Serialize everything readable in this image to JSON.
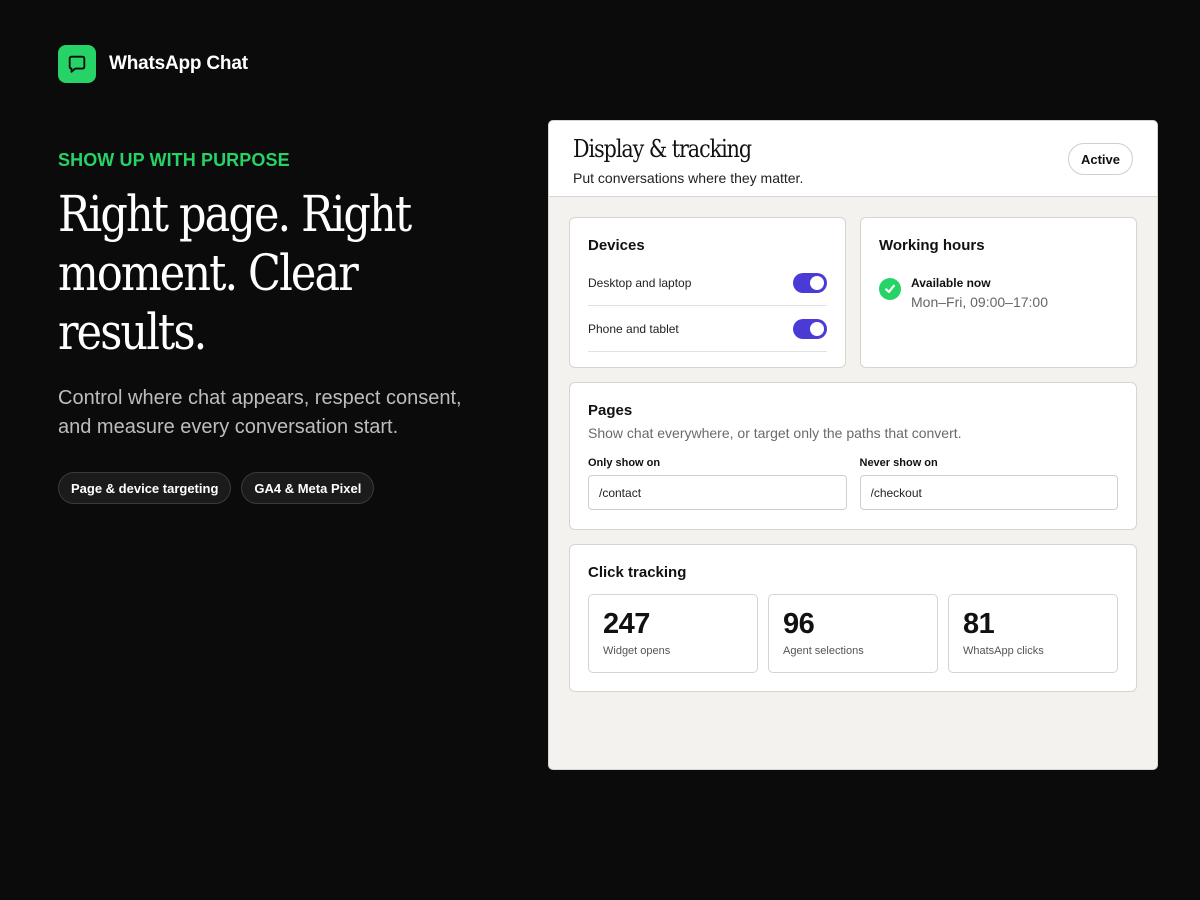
{
  "brand": {
    "name": "WhatsApp Chat",
    "icon": "chat-bubble-icon",
    "color": "#25d366"
  },
  "hero": {
    "eyebrow": "SHOW UP WITH PURPOSE",
    "headline": "Right page. Right moment. Clear results.",
    "subtext": "Control where chat appears, respect consent, and measure every conversation start.",
    "pills": [
      "Page & device targeting",
      "GA4 & Meta Pixel"
    ]
  },
  "panel": {
    "title": "Display & tracking",
    "subtitle": "Put conversations where they matter.",
    "status": "Active"
  },
  "devices": {
    "title": "Devices",
    "items": [
      {
        "label": "Desktop and laptop",
        "enabled": true
      },
      {
        "label": "Phone and tablet",
        "enabled": true
      }
    ],
    "toggle_color": "#4b3bd6"
  },
  "hours": {
    "title": "Working hours",
    "status": "Available now",
    "schedule": "Mon–Fri, 09:00–17:00",
    "icon": "check-circle-icon"
  },
  "pages": {
    "title": "Pages",
    "description": "Show chat everywhere, or target only the paths that convert.",
    "only_label": "Only show on",
    "only_value": "/contact",
    "never_label": "Never show on",
    "never_value": "/checkout"
  },
  "tracking": {
    "title": "Click tracking",
    "stats": [
      {
        "value": "247",
        "label": "Widget opens"
      },
      {
        "value": "96",
        "label": "Agent selections"
      },
      {
        "value": "81",
        "label": "WhatsApp clicks"
      }
    ]
  }
}
